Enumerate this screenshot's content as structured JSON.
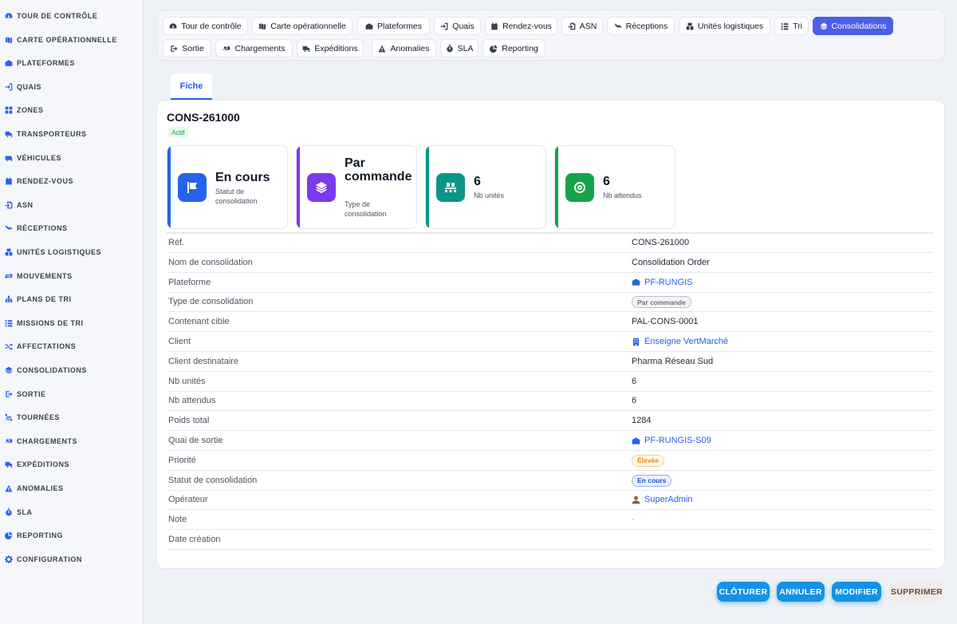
{
  "sidebar": {
    "items": [
      {
        "label": "Tour de contrôle",
        "icon": "dashboard-icon"
      },
      {
        "label": "Carte opérationnelle",
        "icon": "map-icon"
      },
      {
        "label": "Plateformes",
        "icon": "warehouse-icon"
      },
      {
        "label": "Quais",
        "icon": "dock-icon"
      },
      {
        "label": "Zones",
        "icon": "grid-icon"
      },
      {
        "label": "Transporteurs",
        "icon": "truck-icon"
      },
      {
        "label": "Véhicules",
        "icon": "van-icon"
      },
      {
        "label": "Rendez-vous",
        "icon": "calendar-icon"
      },
      {
        "label": "ASN",
        "icon": "file-import-icon"
      },
      {
        "label": "Réceptions",
        "icon": "receive-icon"
      },
      {
        "label": "Unités logistiques",
        "icon": "boxes-icon"
      },
      {
        "label": "Mouvements",
        "icon": "arrows-icon"
      },
      {
        "label": "Plans de tri",
        "icon": "sitemap-icon"
      },
      {
        "label": "Missions de tri",
        "icon": "list-icon"
      },
      {
        "label": "Affectations",
        "icon": "shuffle-icon"
      },
      {
        "label": "Consolidations",
        "icon": "layers-icon"
      },
      {
        "label": "Sortie",
        "icon": "exit-icon"
      },
      {
        "label": "Tournées",
        "icon": "route-icon"
      },
      {
        "label": "Chargements",
        "icon": "loading-icon"
      },
      {
        "label": "Expéditions",
        "icon": "shipping-icon"
      },
      {
        "label": "Anomalies",
        "icon": "warning-icon"
      },
      {
        "label": "SLA",
        "icon": "stopwatch-icon"
      },
      {
        "label": "Reporting",
        "icon": "chart-pie-icon"
      },
      {
        "label": "Configuration",
        "icon": "gear-icon"
      }
    ]
  },
  "topnav": {
    "items": [
      {
        "label": "Tour de contrôle",
        "icon": "dashboard-icon"
      },
      {
        "label": "Carte opérationnelle",
        "icon": "map-icon"
      },
      {
        "label": "Plateformes",
        "icon": "warehouse-icon"
      },
      {
        "label": "Quais",
        "icon": "dock-icon"
      },
      {
        "label": "Rendez-vous",
        "icon": "calendar-icon"
      },
      {
        "label": "ASN",
        "icon": "file-import-icon"
      },
      {
        "label": "Réceptions",
        "icon": "receive-icon"
      },
      {
        "label": "Unités logistiques",
        "icon": "boxes-icon"
      },
      {
        "label": "Tri",
        "icon": "list-icon"
      },
      {
        "label": "Consolidations",
        "icon": "layers-icon",
        "active": true
      },
      {
        "label": "Sortie",
        "icon": "exit-icon"
      },
      {
        "label": "Chargements",
        "icon": "loading-icon"
      },
      {
        "label": "Expéditions",
        "icon": "shipping-icon"
      },
      {
        "label": "Anomalies",
        "icon": "warning-icon"
      },
      {
        "label": "SLA",
        "icon": "stopwatch-icon"
      },
      {
        "label": "Reporting",
        "icon": "chart-pie-icon"
      }
    ]
  },
  "tab": {
    "label": "Fiche"
  },
  "record": {
    "title": "CONS-261000",
    "status_badge": "Actif"
  },
  "kpis": [
    {
      "value": "En cours",
      "label": "Statut de consolidation",
      "color": "#2563eb",
      "icon": "flag-icon"
    },
    {
      "value": "Par commande",
      "label": "Type de consolidation",
      "color": "#7c3aed",
      "icon": "layers-icon"
    },
    {
      "value": "6",
      "label": "Nb unités",
      "color": "#0d9488",
      "icon": "pallet-icon"
    },
    {
      "value": "6",
      "label": "Nb attendus",
      "color": "#16a34a",
      "icon": "target-icon"
    }
  ],
  "fields": [
    {
      "key": "Réf.",
      "value": "CONS-261000"
    },
    {
      "key": "Nom de consolidation",
      "value": "Consolidation Order"
    },
    {
      "key": "Plateforme",
      "value": "PF-RUNGIS",
      "type": "link",
      "icon": "warehouse-icon"
    },
    {
      "key": "Type de consolidation",
      "value": "Par commande",
      "type": "pill",
      "pill_color": "#6b7280",
      "pill_bg": "#f3f4f6"
    },
    {
      "key": "Contenant cible",
      "value": "PAL-CONS-0001"
    },
    {
      "key": "Client",
      "value": "Enseigne VertMarché",
      "type": "link",
      "icon": "building-icon"
    },
    {
      "key": "Client destinataire",
      "value": "Pharma Réseau Sud"
    },
    {
      "key": "Nb unités",
      "value": "6"
    },
    {
      "key": "Nb attendus",
      "value": "6"
    },
    {
      "key": "Poids total",
      "value": "1284"
    },
    {
      "key": "Quai de sortie",
      "value": "PF-RUNGIS-S09",
      "type": "link",
      "icon": "warehouse-icon"
    },
    {
      "key": "Priorité",
      "value": "Élevée",
      "type": "pill",
      "pill_color": "#ea8a1a",
      "pill_bg": "#fff7ea"
    },
    {
      "key": "Statut de consolidation",
      "value": "En cours",
      "type": "pill",
      "pill_color": "#1d4ed8",
      "pill_bg": "#eaf1ff"
    },
    {
      "key": "Opérateur",
      "value": "SuperAdmin",
      "type": "link",
      "icon": "user-icon"
    },
    {
      "key": "Note",
      "value": "-",
      "type": "muted"
    },
    {
      "key": "Date création",
      "value": ""
    }
  ],
  "actions": {
    "close": "CLÔTURER",
    "cancel": "ANNULER",
    "edit": "MODIFIER",
    "delete": "SUPPRIMER"
  }
}
